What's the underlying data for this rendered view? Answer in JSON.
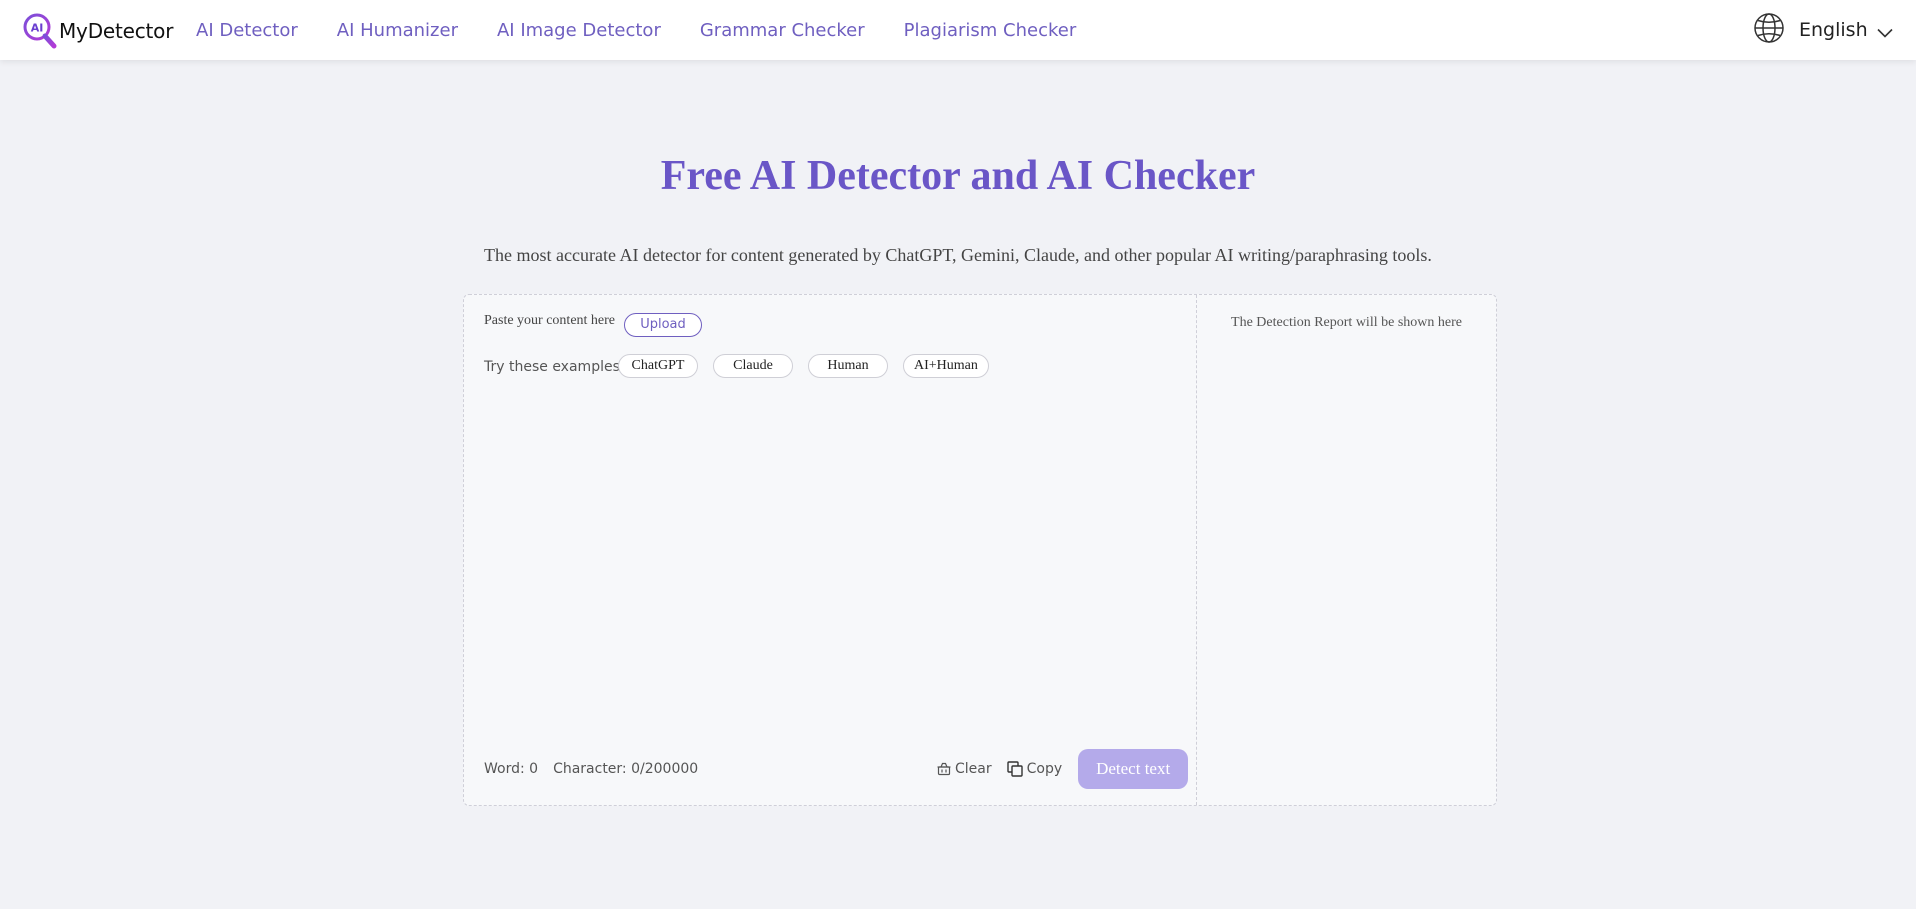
{
  "header": {
    "brand": "MyDetector",
    "logo_text": "AI",
    "nav": [
      {
        "label": "AI Detector"
      },
      {
        "label": "AI Humanizer"
      },
      {
        "label": "AI Image Detector"
      },
      {
        "label": "Grammar Checker"
      },
      {
        "label": "Plagiarism Checker"
      }
    ],
    "language": "English",
    "language_icon": "globe-icon"
  },
  "hero": {
    "title": "Free AI Detector and AI Checker",
    "subtitle": "The most accurate AI detector for content generated by ChatGPT, Gemini, Claude, and other popular AI writing/paraphrasing tools."
  },
  "editor": {
    "paste_label": "Paste your content here",
    "upload_label": "Upload",
    "examples_label": "Try these examples:",
    "examples": [
      "ChatGPT",
      "Claude",
      "Human",
      "AI+Human"
    ],
    "text_value": "",
    "word_count": "Word: 0",
    "char_count": "Character: 0/200000",
    "clear_label": "Clear",
    "copy_label": "Copy",
    "detect_label": "Detect text"
  },
  "report": {
    "placeholder": "The Detection Report will be shown here"
  },
  "colors": {
    "accent": "#6a56c7",
    "nav": "#6f5fc0",
    "detect_button": "#b4aaea",
    "background": "#f1f2f6"
  }
}
